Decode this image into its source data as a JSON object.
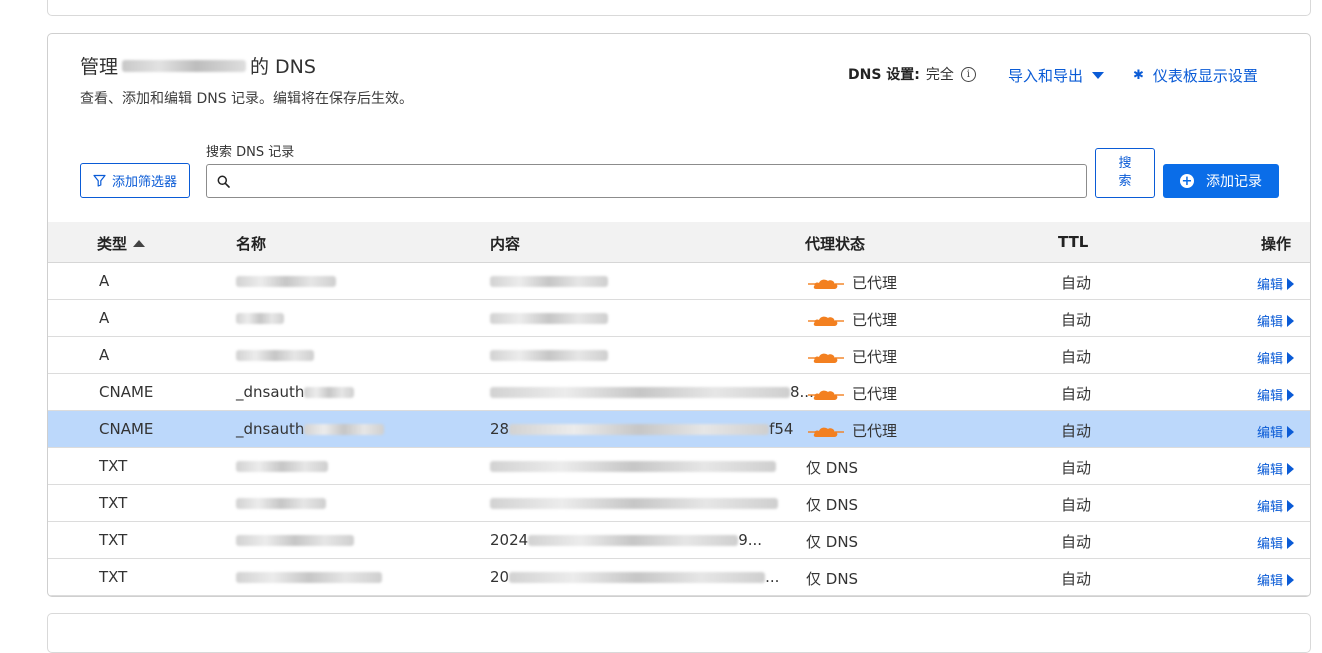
{
  "header": {
    "title_prefix": "管理",
    "title_suffix": "的 DNS",
    "subtitle": "查看、添加和编辑 DNS 记录。编辑将在保存后生效。",
    "dns_setting_label": "DNS 设置:",
    "dns_setting_value": "完全",
    "info_icon": "info-icon",
    "import_export_label": "导入和导出",
    "dashboard_settings_label": "仪表板显示设置"
  },
  "search": {
    "label": "搜索 DNS 记录",
    "value": "",
    "placeholder": "",
    "button_label_line1": "搜",
    "button_label_line2": "索"
  },
  "toolbar": {
    "filter_label": "添加筛选器",
    "add_record_label": "添加记录"
  },
  "table": {
    "columns": {
      "type": "类型",
      "name": "名称",
      "content": "内容",
      "proxy_status": "代理状态",
      "ttl": "TTL",
      "actions": "操作"
    },
    "rows": [
      {
        "type": "A",
        "name_visible": "",
        "content_visible": "",
        "proxy": "已代理",
        "proxied": true,
        "ttl": "自动",
        "edit": "编辑"
      },
      {
        "type": "A",
        "name_visible": "",
        "content_visible": "",
        "proxy": "已代理",
        "proxied": true,
        "ttl": "自动",
        "edit": "编辑"
      },
      {
        "type": "A",
        "name_visible": "",
        "content_visible": "",
        "proxy": "已代理",
        "proxied": true,
        "ttl": "自动",
        "edit": "编辑"
      },
      {
        "type": "CNAME",
        "name_visible": "_dnsauth",
        "content_visible": "",
        "content_tail": "8...",
        "proxy": "已代理",
        "proxied": true,
        "ttl": "自动",
        "edit": "编辑"
      },
      {
        "type": "CNAME",
        "name_visible": "_dnsauth",
        "content_visible": "28",
        "content_tail": "f54",
        "proxy": "已代理",
        "proxied": true,
        "ttl": "自动",
        "edit": "编辑",
        "selected": true
      },
      {
        "type": "TXT",
        "name_visible": "",
        "content_visible": "",
        "proxy": "仅 DNS",
        "proxied": false,
        "ttl": "自动",
        "edit": "编辑"
      },
      {
        "type": "TXT",
        "name_visible": "",
        "content_visible": "",
        "proxy": "仅 DNS",
        "proxied": false,
        "ttl": "自动",
        "edit": "编辑"
      },
      {
        "type": "TXT",
        "name_visible": "",
        "content_visible": "2024",
        "content_tail": "9...",
        "proxy": "仅 DNS",
        "proxied": false,
        "ttl": "自动",
        "edit": "编辑"
      },
      {
        "type": "TXT",
        "name_visible": "",
        "content_visible": "20",
        "content_tail": "...",
        "proxy": "仅 DNS",
        "proxied": false,
        "ttl": "自动",
        "edit": "编辑"
      }
    ]
  },
  "colors": {
    "accent": "#0a5bd6",
    "primary_button": "#0a6de8",
    "selected_row": "#bcd8fb",
    "cloud_orange": "#f38020",
    "header_bg": "#f2f2f2"
  }
}
